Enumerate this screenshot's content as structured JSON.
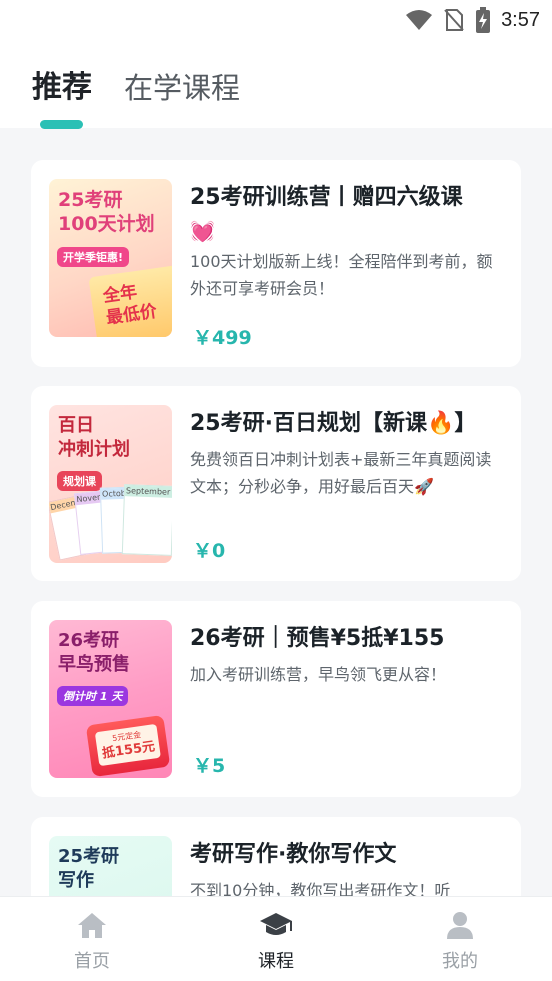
{
  "status_bar": {
    "time": "3:57",
    "icons": [
      "wifi-icon",
      "no-sim-icon",
      "battery-charging-icon"
    ]
  },
  "tabs": [
    {
      "label": "推荐",
      "active": true
    },
    {
      "label": "在学课程",
      "active": false
    }
  ],
  "courses": [
    {
      "thumb_lines": [
        "25考研",
        "100天计划"
      ],
      "thumb_pill": "开学季钜惠!",
      "thumb_badge": [
        "全年",
        "最低价"
      ],
      "title": "25考研训练营丨赠四六级课",
      "title_emoji": "💓",
      "desc": "100天计划版新上线！全程陪伴到考前，额外还可享考研会员！",
      "price": "￥499"
    },
    {
      "thumb_lines": [
        "百日",
        "冲刺计划"
      ],
      "thumb_pill": "规划课",
      "thumb_tabs": [
        "Decem",
        "Novem",
        "Octob",
        "September"
      ],
      "title": "25考研·百日规划【新课🔥】",
      "desc": "免费领百日冲刺计划表+最新三年真题阅读文本；分秒必争，用好最后百天🚀",
      "price": "￥0"
    },
    {
      "thumb_lines": [
        "26考研",
        "早鸟预售"
      ],
      "thumb_pill": "倒计时 1 天",
      "thumb_coupon": [
        "5元定金",
        "抵155元"
      ],
      "title": "26考研｜预售¥5抵¥155",
      "desc": "加入考研训练营，早鸟领飞更从容！",
      "price": "￥5"
    },
    {
      "thumb_lines": [
        "25考研",
        "写作"
      ],
      "title": "考研写作·教你写作文",
      "desc": "不到10分钟，教你写出考研作文！听"
    }
  ],
  "bottom_nav": [
    {
      "label": "首页",
      "icon": "home-icon",
      "active": false
    },
    {
      "label": "课程",
      "icon": "graduation-cap-icon",
      "active": true
    },
    {
      "label": "我的",
      "icon": "person-icon",
      "active": false
    }
  ],
  "colors": {
    "accent": "#2bc0b5",
    "price": "#27b6ad"
  }
}
